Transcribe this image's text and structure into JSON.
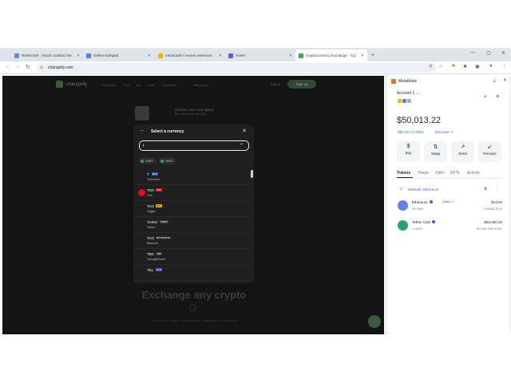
{
  "browser": {
    "tabs": [
      {
        "label": "Remix IDE - Smart Contract De",
        "active": false,
        "color": "#6d85d6"
      },
      {
        "label": "Online Notepad",
        "active": false,
        "color": "#4a86e8"
      },
      {
        "label": "metamask ri evone extension",
        "active": false,
        "color": "#f4b400"
      },
      {
        "label": "Home",
        "active": false,
        "color": "#5b5fc7"
      },
      {
        "label": "Cryptocurrency Exchange - Cry",
        "active": true,
        "color": "#3cb043"
      }
    ],
    "url": "changelly.com"
  },
  "site": {
    "brand": "changelly",
    "nav": [
      "Exchange",
      "Buy",
      "Sell",
      "Swap",
      "Currencies",
      "Resources"
    ],
    "login": "Log in",
    "signup": "Sign up",
    "promo_title": "Choose your card option",
    "promo_sub": "Buy crypto with your card",
    "hero_title": "Exchange any crypto",
    "hero_sub": "Changelly is an instant crypto exchange. Swap crypto at the best rates"
  },
  "modal": {
    "title": "Select a currency",
    "search_value": "t",
    "chips": [
      {
        "label": "USDT",
        "color": "#26a17b"
      },
      {
        "label": "USDT",
        "color": "#26a17b"
      }
    ],
    "currencies": [
      {
        "symbol": "T",
        "network": "ETH",
        "name": "Threshold",
        "icon_color": "#7b4bff",
        "net_bg": "#3d4fd6",
        "net_fg": "#ffffff"
      },
      {
        "symbol": "TRX",
        "network": "TRX",
        "name": "Tron",
        "icon_color": "#e50915",
        "net_bg": "#e50915",
        "net_fg": "#ffffff"
      },
      {
        "symbol": "TAO",
        "network": "BSC",
        "name": "Tagger",
        "icon_color": "#1f1f1f",
        "net_bg": "#f0b90b",
        "net_fg": "#1f1f1f"
      },
      {
        "symbol": "TAIKO",
        "network": "TAIKO",
        "name": "TAIKO",
        "icon_color": "#1f1f1f",
        "net_bg": "#3a3a3a",
        "net_fg": "#ffffff"
      },
      {
        "symbol": "TAO",
        "network": "BITTENSOR",
        "name": "Bittensor",
        "icon_color": "#1f1f1f",
        "net_bg": "#2a2a2a",
        "net_fg": "#ffffff"
      },
      {
        "symbol": "TBC",
        "network": "TBC",
        "name": "TuringBitChain",
        "icon_color": "#1f1f1f",
        "net_bg": "#3a3a3a",
        "net_fg": "#ffffff"
      },
      {
        "symbol": "TEL",
        "network": "ETH",
        "name": "",
        "icon_color": "#1f1f1f",
        "net_bg": "#3d4fd6",
        "net_fg": "#ffffff"
      }
    ]
  },
  "metamask": {
    "app_name": "MetaMask",
    "account": "Account 1",
    "balance": "$50,013.22",
    "change": "+$0.10 (+0.78%)",
    "discover": "Discover",
    "actions": [
      {
        "label": "Buy",
        "icon": "$"
      },
      {
        "label": "Swap",
        "icon": "⇅"
      },
      {
        "label": "Send",
        "icon": "↗"
      },
      {
        "label": "Receive",
        "icon": "↙"
      }
    ],
    "tabs": [
      "Tokens",
      "Perps",
      "DeFi",
      "NFTs",
      "Activity"
    ],
    "network_filter": "Network: Ethereum",
    "tokens": [
      {
        "name": "Ethereum",
        "earn": "Earn",
        "change": "+0.79%",
        "change_color": "#1c8234",
        "fiat": "$13.02",
        "amount": "0.00481 ETH",
        "icon_color": "#627eea"
      },
      {
        "name": "Tether USD",
        "earn": "",
        "change": "-0.02%",
        "change_color": "#d73847",
        "fiat": "$50,000.20",
        "amount": "50,000.198 USDT",
        "icon_color": "#26a17b"
      }
    ],
    "accent": "#4459ff"
  }
}
